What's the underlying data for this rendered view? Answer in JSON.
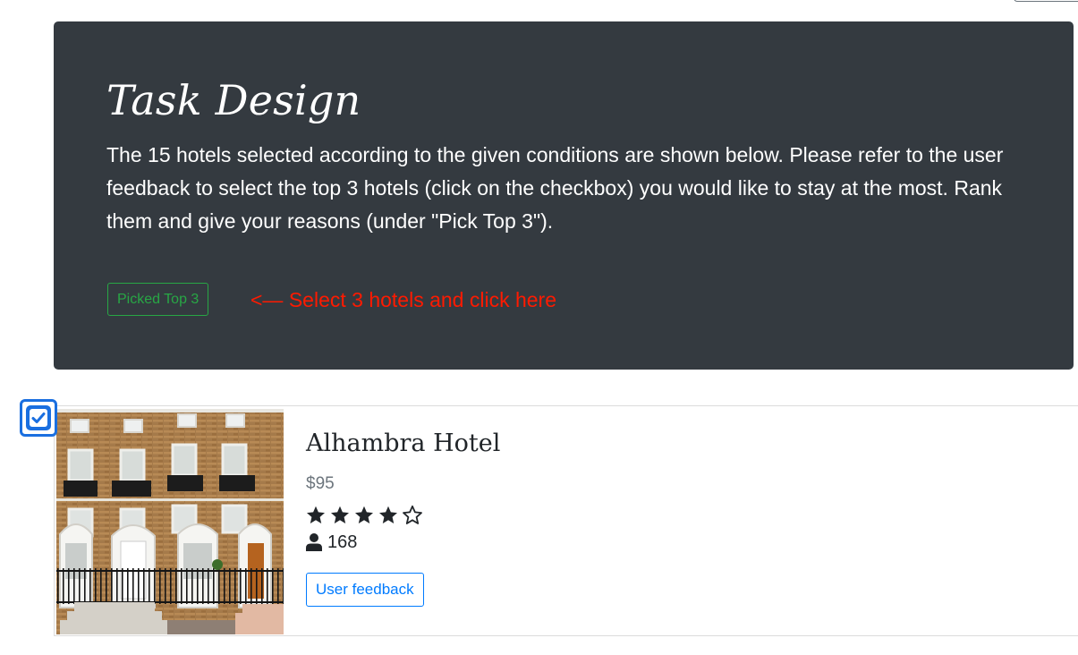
{
  "header": {
    "title": "Task Design",
    "description": "The 15 hotels selected according to the given conditions are shown below. Please refer to the user feedback to select the top 3 hotels (click on the checkbox) you would like to stay at the most. Rank them and give your reasons (under \"Pick Top 3\").",
    "picked_button_label": "Picked Top 3",
    "hint": "<— Select 3 hotels and click here"
  },
  "colors": {
    "jumbotron_bg": "#343a40",
    "accent_green": "#28a745",
    "accent_blue": "#007bff",
    "hint_red": "#ff1a00",
    "checkbox_blue": "#1a6fe0"
  },
  "hotels": [
    {
      "selected": true,
      "name": "Alhambra Hotel",
      "price": "$95",
      "rating": 4,
      "rating_max": 5,
      "reviews_icon": "user-icon",
      "reviews": "168",
      "feedback_label": "User feedback",
      "image_icon": "hotel-photo"
    }
  ]
}
